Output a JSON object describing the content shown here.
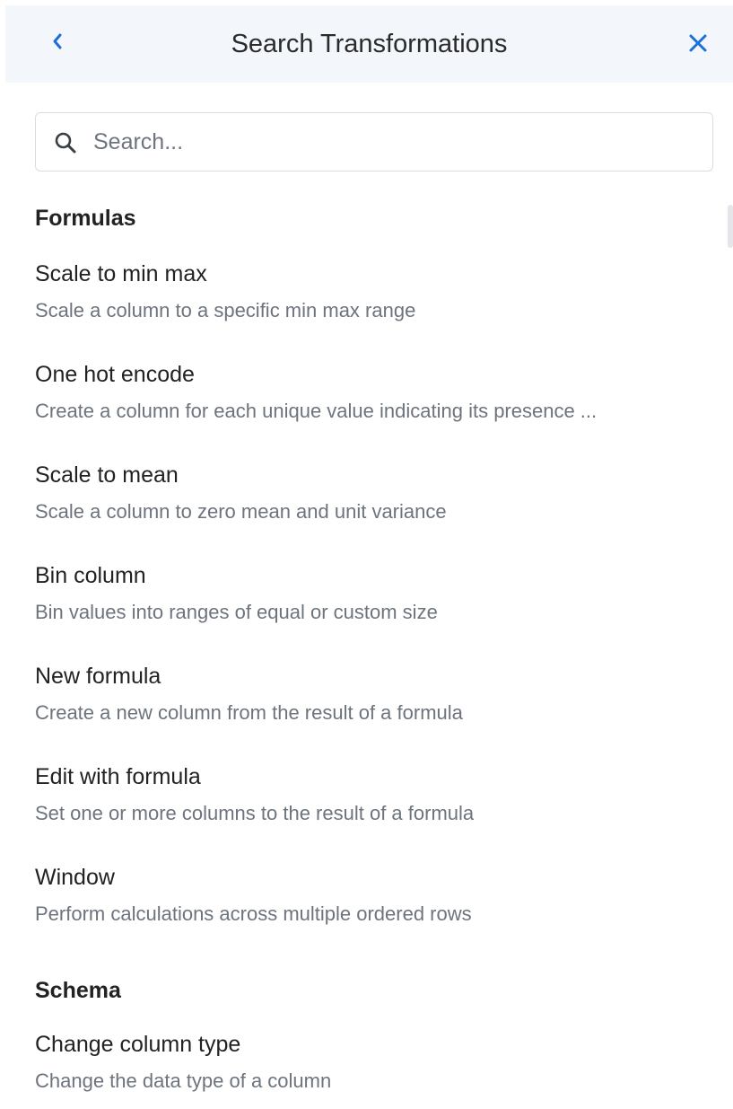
{
  "header": {
    "title": "Search Transformations",
    "back_icon": "chevron-left-icon",
    "close_icon": "close-icon",
    "accent_color": "#1a6fd8"
  },
  "search": {
    "placeholder": "Search...",
    "value": "",
    "icon": "search-icon"
  },
  "sections": [
    {
      "title": "Formulas",
      "items": [
        {
          "title": "Scale to min max",
          "description": "Scale a column to a specific min max range"
        },
        {
          "title": "One hot encode",
          "description": "Create a column for each unique value indicating its presence ..."
        },
        {
          "title": "Scale to mean",
          "description": "Scale a column to zero mean and unit variance"
        },
        {
          "title": "Bin column",
          "description": "Bin values into ranges of equal or custom size"
        },
        {
          "title": "New formula",
          "description": "Create a new column from the result of a formula"
        },
        {
          "title": "Edit with formula",
          "description": "Set one or more columns to the result of a formula"
        },
        {
          "title": "Window",
          "description": "Perform calculations across multiple ordered rows"
        }
      ]
    },
    {
      "title": "Schema",
      "items": [
        {
          "title": "Change column type",
          "description": "Change the data type of a column"
        }
      ]
    }
  ]
}
